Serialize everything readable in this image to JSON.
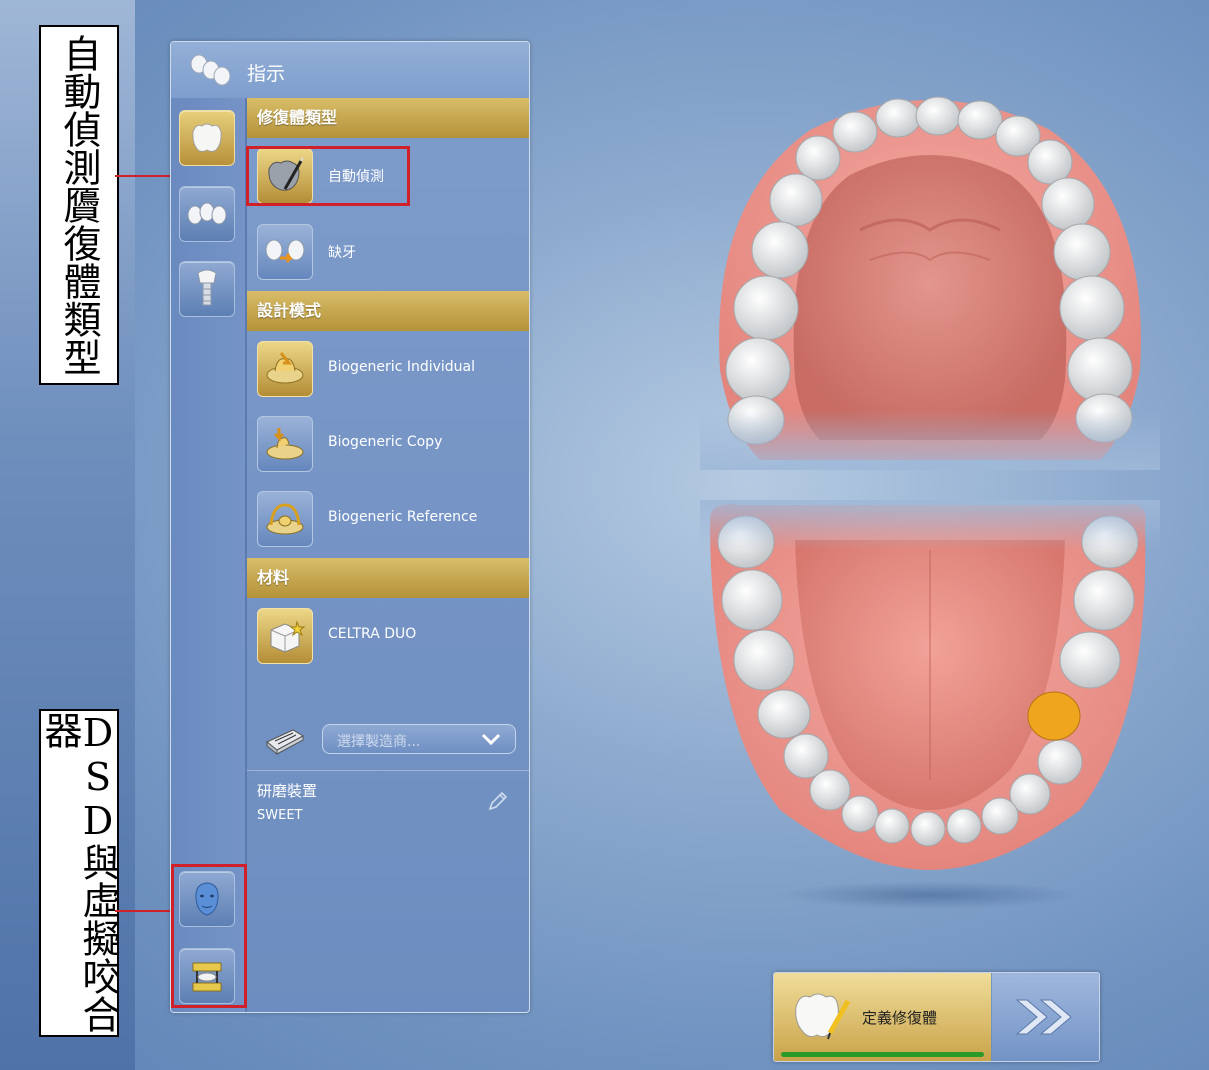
{
  "annotations": {
    "top_label": "自動偵測贗復體類型",
    "bottom_label": "DSD與虛擬咬合器"
  },
  "panel": {
    "title": "指示",
    "sections": {
      "restoration_type": "修復體類型",
      "design_mode": "設計模式",
      "material": "材料"
    },
    "restoration_items": [
      "自動偵測",
      "缺牙"
    ],
    "design_items": [
      "Biogeneric Individual",
      "Biogeneric Copy",
      "Biogeneric Reference"
    ],
    "material_item": "CELTRA DUO",
    "manufacturer_select": {
      "placeholder": "選擇製造商..."
    },
    "grinding": {
      "label": "研磨裝置",
      "value": "SWEET"
    }
  },
  "next": {
    "label": "定義修復體",
    "progress_fraction": 1.0
  },
  "colors": {
    "accent_gold": "#c9a34a",
    "callout_red": "#d0202a",
    "selected_tooth": "#f0a51f",
    "progress_green": "#2a9a28"
  }
}
